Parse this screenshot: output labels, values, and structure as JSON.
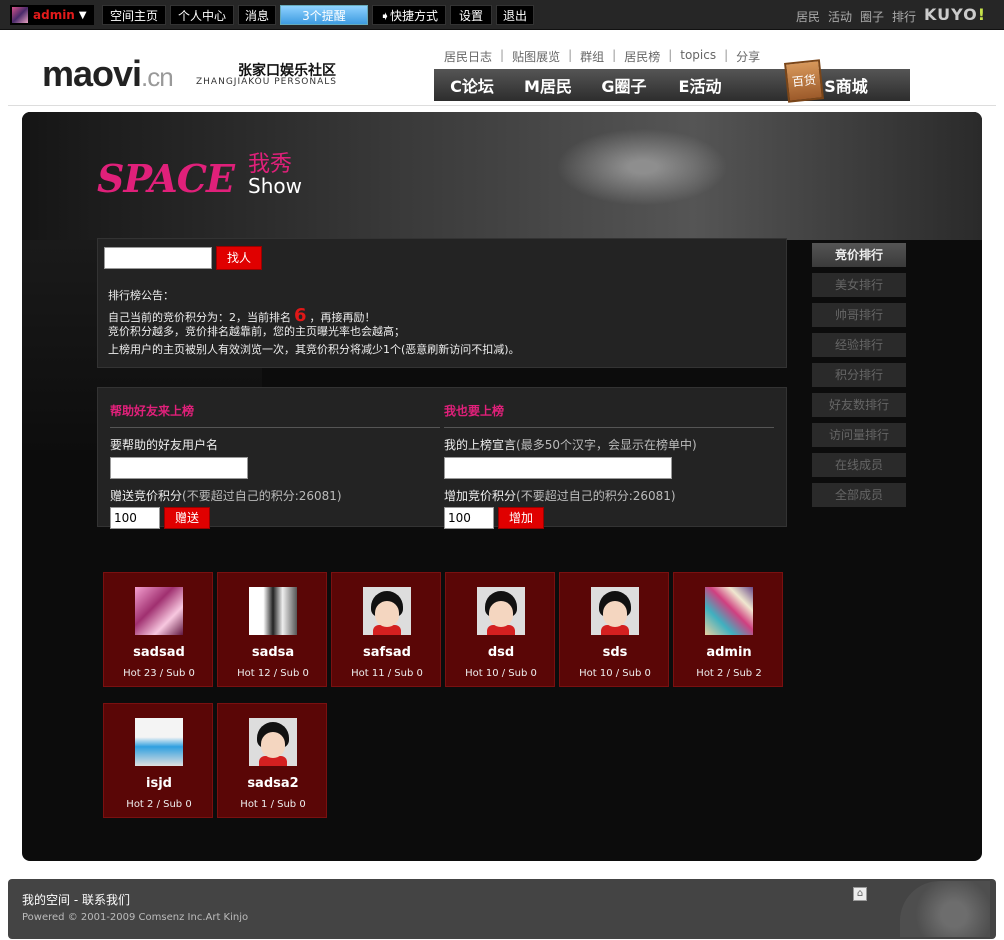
{
  "topbar": {
    "username": "admin",
    "buttons": [
      "空间主页",
      "个人中心",
      "消息",
      "3个提醒",
      "快捷方式",
      "设置",
      "退出"
    ],
    "right_links": [
      "居民",
      "活动",
      "圈子",
      "排行"
    ],
    "brand": "KUYO",
    "brand_accent": "!"
  },
  "header": {
    "logo": "maovi",
    "logo_domain": ".cn",
    "logo_cn": "张家口娱乐社区",
    "logo_en": "ZHANGJIAKOU PERSONALS",
    "sub_links": [
      "居民日志",
      "贴图展览",
      "群组",
      "居民榜",
      "topics",
      "分享"
    ],
    "main_nav": [
      "C论坛",
      "M居民",
      "G圈子",
      "E活动",
      "S商城"
    ],
    "mall_icon_label": "百货"
  },
  "banner": {
    "space": "SPACE",
    "cn": "我秀",
    "show": "Show"
  },
  "notice": {
    "search_button": "找人",
    "title": "排行榜公告：",
    "line1_pre": "自己当前的竞价积分为：2，当前排名",
    "rank": "6",
    "line1_post": "，再接再励！",
    "line2": "竞价积分越多，竞价排名越靠前，您的主页曝光率也会越高；",
    "line3": "上榜用户的主页被别人有效浏览一次，其竞价积分将减少1个(恶意刷新访问不扣减)。"
  },
  "right_tabs": [
    "竞价排行",
    "美女排行",
    "帅哥排行",
    "经验排行",
    "积分排行",
    "好友数排行",
    "访问量排行",
    "在线成员",
    "全部成员"
  ],
  "help_form": {
    "title": "帮助好友来上榜",
    "label_user": "要帮助的好友用户名",
    "label_points": "赠送竞价积分",
    "hint": "(不要超过自己的积分:26081)",
    "value": "100",
    "button": "赠送"
  },
  "self_form": {
    "title": "我也要上榜",
    "label_msg": "我的上榜宣言",
    "msg_hint": "(最多50个汉字，会显示在榜单中)",
    "label_points": "增加竞价积分",
    "hint": "(不要超过自己的积分:26081)",
    "value": "100",
    "button": "增加"
  },
  "users": [
    {
      "name": "sadsad",
      "stats": "Hot 23 / Sub 0",
      "avatar": "pink-photo"
    },
    {
      "name": "sadsa",
      "stats": "Hot 12 / Sub 0",
      "avatar": "bw-photo"
    },
    {
      "name": "safsad",
      "stats": "Hot 11 / Sub 0",
      "avatar": "default-face"
    },
    {
      "name": "dsd",
      "stats": "Hot 10 / Sub 0",
      "avatar": "default-face"
    },
    {
      "name": "sds",
      "stats": "Hot 10 / Sub 0",
      "avatar": "default-face"
    },
    {
      "name": "admin",
      "stats": "Hot 2 / Sub 2",
      "avatar": "colorful-photo"
    },
    {
      "name": "isjd",
      "stats": "Hot 2 / Sub 0",
      "avatar": "blue-photo"
    },
    {
      "name": "sadsa2",
      "stats": "Hot 1 / Sub 0",
      "avatar": "default-face"
    }
  ],
  "footer": {
    "link1": "我的空间",
    "link2": "- 联系我们",
    "powered": "Powered © 2001-2009 Comsenz Inc.Art Kinjo"
  },
  "colors": {
    "accent": "#e0207a",
    "button_red": "#e00000",
    "card_bg": "#5a0606"
  }
}
